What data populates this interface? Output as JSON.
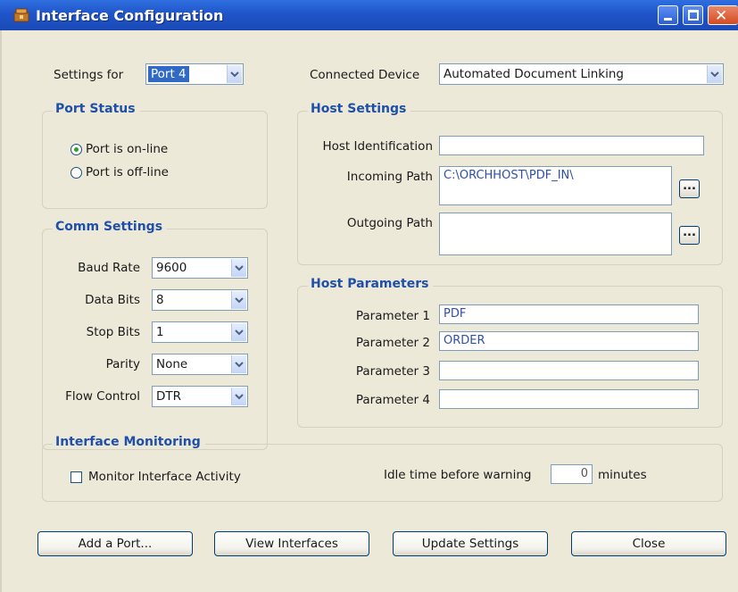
{
  "window": {
    "title": "Interface Configuration"
  },
  "top": {
    "settings_for_label": "Settings for",
    "settings_for_value": "Port  4",
    "connected_device_label": "Connected Device",
    "connected_device_value": "Automated Document Linking"
  },
  "port_status": {
    "title": "Port Status",
    "online_label": "Port is on-line",
    "offline_label": "Port is off-line",
    "selected": "online"
  },
  "comm_settings": {
    "title": "Comm Settings",
    "rows": [
      {
        "label": "Baud Rate",
        "value": "9600"
      },
      {
        "label": "Data Bits",
        "value": "8"
      },
      {
        "label": "Stop Bits",
        "value": "1"
      },
      {
        "label": "Parity",
        "value": "None"
      },
      {
        "label": "Flow Control",
        "value": "DTR"
      }
    ]
  },
  "host_settings": {
    "title": "Host Settings",
    "host_id_label": "Host Identification",
    "host_id_value": "",
    "incoming_label": "Incoming Path",
    "incoming_value": "C:\\ORCHHOST\\PDF_IN\\",
    "outgoing_label": "Outgoing Path",
    "outgoing_value": "",
    "browse_label": "..."
  },
  "host_parameters": {
    "title": "Host Parameters",
    "rows": [
      {
        "label": "Parameter 1",
        "value": "PDF"
      },
      {
        "label": "Parameter 2",
        "value": "ORDER"
      },
      {
        "label": "Parameter 3",
        "value": ""
      },
      {
        "label": "Parameter 4",
        "value": ""
      }
    ]
  },
  "monitoring": {
    "title": "Interface Monitoring",
    "checkbox_label": "Monitor Interface Activity",
    "checked": false,
    "idle_label": "Idle time before warning",
    "idle_value": "0",
    "idle_unit": "minutes"
  },
  "buttons": {
    "add_port": "Add a Port...",
    "view_interfaces": "View Interfaces",
    "update_settings": "Update Settings",
    "close": "Close"
  },
  "colors": {
    "title_bar": "#1f55c9",
    "group_title": "#1f4fa8",
    "field_text": "#3050a8",
    "selection": "#316ac5"
  }
}
